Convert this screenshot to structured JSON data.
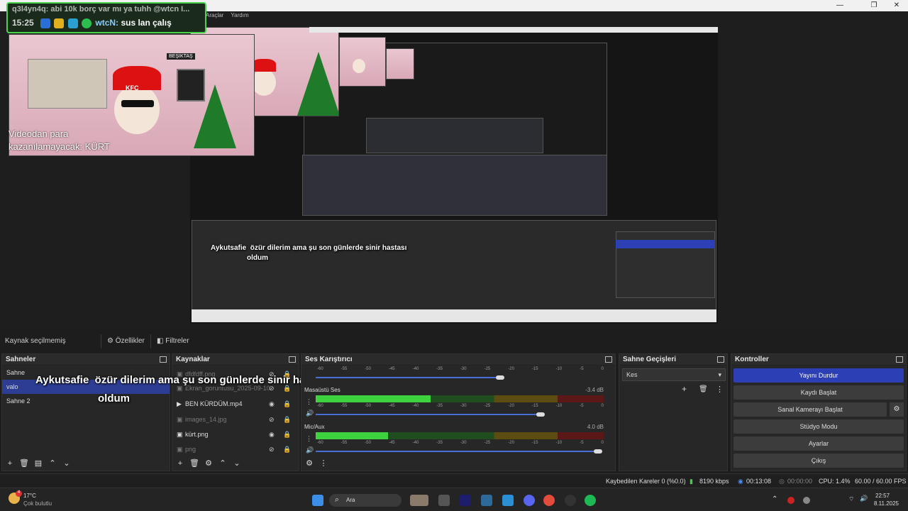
{
  "window": {
    "minimize": "—",
    "maximize": "❐",
    "close": "✕"
  },
  "menu": {
    "items": [
      "Araçlar",
      "Yardım"
    ]
  },
  "chat": {
    "line1": "q3l4yn4q: abi 10k borç var mı ya tuhh @wtcn I...",
    "time": "15:25",
    "user": "wtcN:",
    "message": "sus lan çalış"
  },
  "webcam": {
    "caption_line1": "Videodan para",
    "caption_line2": "kazanılamayacak: KÜRT",
    "frame_label": "BEŞİKTAŞ",
    "hat_text": "KFC"
  },
  "overlay": {
    "name": "Aykutsafie",
    "message": "özür dilerim ama şu son günlerde sinir hastası",
    "message2": "oldum"
  },
  "source_bar": {
    "label": "Kaynak seçilmemiş",
    "properties": "Özellikler",
    "filters": "Filtreler"
  },
  "scenes": {
    "title": "Sahneler",
    "items": [
      "Sahne",
      "valo",
      "Sahne 2"
    ],
    "selected": 1
  },
  "sources": {
    "title": "Kaynaklar",
    "items": [
      {
        "name": "dfdfdff.png",
        "icon": "image-icon",
        "visible": false
      },
      {
        "name": "Ekran_goruntusu_2025-09-10",
        "icon": "image-icon",
        "visible": false
      },
      {
        "name": "BEN KÜRDÜM.mp4",
        "icon": "play-icon",
        "visible": true
      },
      {
        "name": "images_14.jpg",
        "icon": "image-icon",
        "visible": false
      },
      {
        "name": "kürt.png",
        "icon": "image-icon",
        "visible": true
      },
      {
        "name": "png",
        "icon": "image-icon",
        "visible": false
      }
    ]
  },
  "mixer": {
    "title": "Ses Karıştırıcı",
    "ticks": [
      "-60",
      "-55",
      "-50",
      "-45",
      "-40",
      "-35",
      "-30",
      "-25",
      "-20",
      "-15",
      "-10",
      "-5",
      "0"
    ],
    "channels": [
      {
        "name": "Masaüstü Ses",
        "db": "-3.4 dB",
        "level": 0.4,
        "volume": 0.78
      },
      {
        "name": "Mic/Aux",
        "db": "4.0 dB",
        "level": 0.25,
        "volume": 0.98
      }
    ]
  },
  "transitions": {
    "title": "Sahne Geçişleri",
    "selected": "Kes"
  },
  "controls": {
    "title": "Kontroller",
    "stop_stream": "Yayını Durdur",
    "start_recording": "Kaydı Başlat",
    "virtual_cam": "Sanal Kamerayı Başlat",
    "studio_mode": "Stüdyo Modu",
    "settings": "Ayarlar",
    "exit": "Çıkış"
  },
  "status": {
    "dropped": "Kaybedilen Kareler 0 (%0.0)",
    "bitrate": "8190 kbps",
    "stream_time": "00:13:08",
    "rec_time": "00:00:00",
    "cpu": "CPU: 1.4%",
    "fps": "60.00 / 60.00 FPS"
  },
  "taskbar": {
    "weather_temp": "17°C",
    "weather_desc": "Çok bulutlu",
    "weather_badge": "4",
    "search": "Ara",
    "time": "22:57",
    "date": "8.11.2025"
  },
  "colors": {
    "accent": "#2d3fb5",
    "chat_border": "#49d44e",
    "meter_green": "#3fd23f"
  }
}
